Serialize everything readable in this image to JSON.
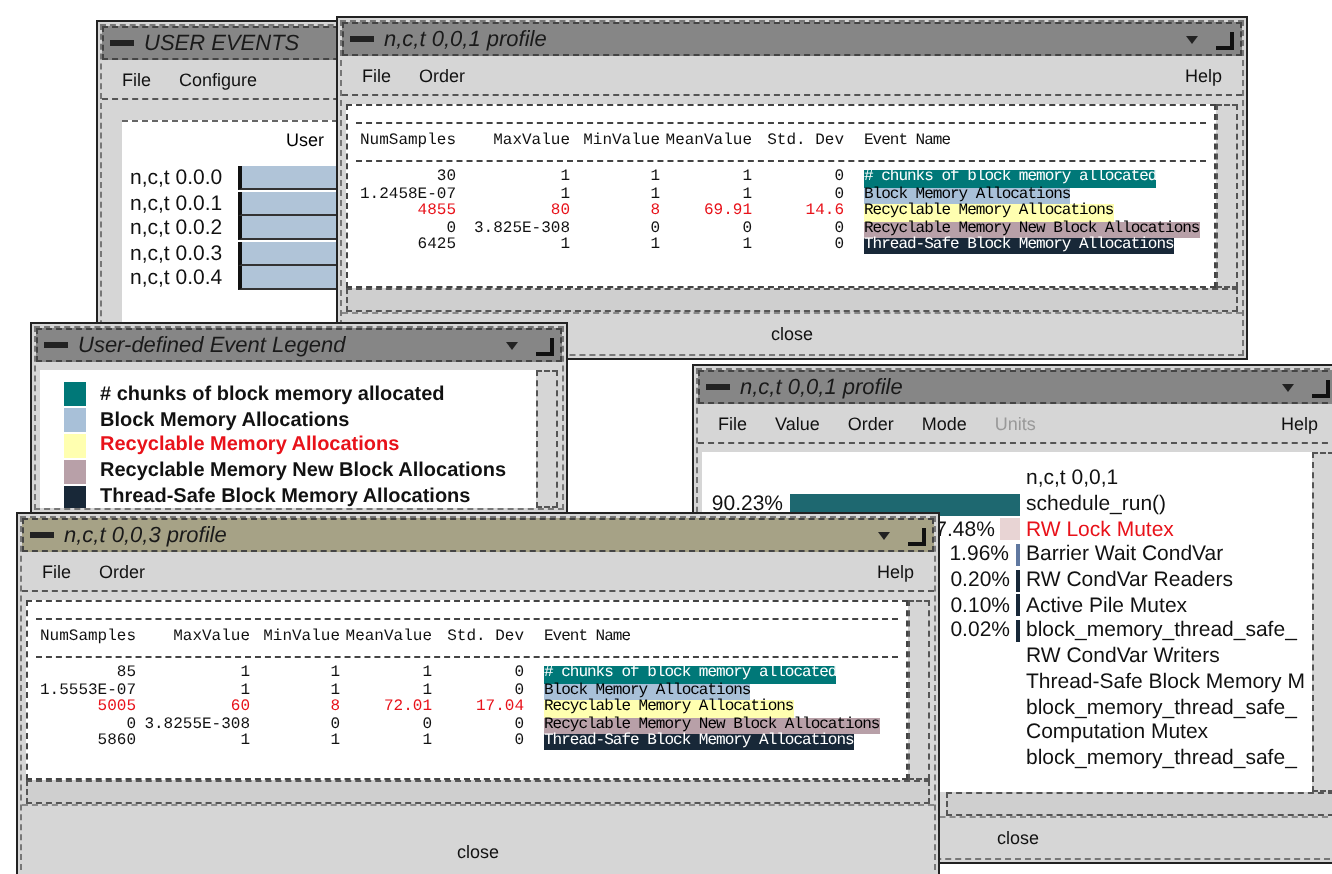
{
  "windows": [
    {
      "kind": "events",
      "title": "USER EVENTS",
      "active": false,
      "menu": [
        {
          "label": "File"
        },
        {
          "label": "Configure"
        }
      ],
      "header": "User",
      "rows": [
        {
          "label": "n,c,t 0.0.0"
        },
        {
          "label": "n,c,t 0.0.1"
        },
        {
          "label": "n,c,t 0.0.2"
        },
        {
          "label": "n,c,t 0.0.3"
        },
        {
          "label": "n,c,t 0.0.4"
        }
      ]
    },
    {
      "kind": "table",
      "title": "n,c,t 0,0,1 profile",
      "active": false,
      "menu": [
        {
          "label": "File"
        },
        {
          "label": "Order"
        }
      ],
      "help": "Help",
      "columns": [
        "NumSamples",
        "MaxValue",
        "MinValue",
        "MeanValue",
        "Std. Dev",
        "Event Name"
      ],
      "rows": [
        {
          "cells": [
            "30",
            "1",
            "1",
            "1",
            "0"
          ],
          "event": "# chunks of block memory allocated",
          "color": "#007878",
          "highlight": false
        },
        {
          "cells": [
            "1.2458E-07",
            "1",
            "1",
            "1",
            "0"
          ],
          "event": "Block Memory Allocations",
          "color": "#a8c0d8",
          "highlight": false
        },
        {
          "cells": [
            "4855",
            "80",
            "8",
            "69.91",
            "14.6"
          ],
          "event": "Recyclable Memory Allocations",
          "color": "#ffffb0",
          "highlight": true
        },
        {
          "cells": [
            "0",
            "3.825E-308",
            "0",
            "0",
            "0"
          ],
          "event": "Recyclable Memory New Block Allocations",
          "color": "#b8a0a8",
          "highlight": false
        },
        {
          "cells": [
            "6425",
            "1",
            "1",
            "1",
            "0"
          ],
          "event": "Thread-Safe Block Memory Allocations",
          "color": "#182838",
          "highlight": false
        }
      ],
      "close": "close"
    },
    {
      "kind": "legend",
      "title": "User-defined Event Legend",
      "active": false,
      "items": [
        {
          "label": "# chunks of block memory allocated",
          "color": "#007878",
          "highlight": false
        },
        {
          "label": "Block Memory Allocations",
          "color": "#a8c0d8",
          "highlight": false
        },
        {
          "label": "Recyclable Memory Allocations",
          "color": "#ffffb0",
          "highlight": true
        },
        {
          "label": "Recyclable Memory New Block Allocations",
          "color": "#b8a0a8",
          "highlight": false
        },
        {
          "label": "Thread-Safe Block Memory Allocations",
          "color": "#182838",
          "highlight": false
        }
      ]
    },
    {
      "kind": "bars",
      "title": "n,c,t 0,0,1 profile",
      "active": false,
      "menu": [
        {
          "label": "File",
          "disabled": false
        },
        {
          "label": "Value",
          "disabled": false
        },
        {
          "label": "Order",
          "disabled": false
        },
        {
          "label": "Mode",
          "disabled": false
        },
        {
          "label": "Units",
          "disabled": true
        }
      ],
      "help": "Help",
      "heading": "n,c,t 0,0,1",
      "rows": [
        {
          "percent": "90.23%",
          "name": "schedule_run()",
          "color": "#1e6870",
          "highlight": false
        },
        {
          "percent": "7.48%",
          "name": "RW Lock Mutex",
          "color": "#e8d4d4",
          "highlight": true
        },
        {
          "percent": "1.96%",
          "name": "Barrier Wait CondVar",
          "color": "#6078a0",
          "highlight": false
        },
        {
          "percent": "0.20%",
          "name": "RW CondVar Readers",
          "color": "#182838",
          "highlight": false
        },
        {
          "percent": "0.10%",
          "name": "Active Pile Mutex",
          "color": "#182838",
          "highlight": false
        },
        {
          "percent": "0.02%",
          "name": "block_memory_thread_safe_",
          "color": "#182838",
          "highlight": false
        },
        {
          "name": "RW CondVar Writers",
          "highlight": false
        },
        {
          "name": "Thread-Safe Block Memory M",
          "highlight": false
        },
        {
          "name": "block_memory_thread_safe_",
          "highlight": false
        },
        {
          "name": "Computation Mutex",
          "highlight": false
        },
        {
          "name": "block_memory_thread_safe_",
          "highlight": false
        }
      ],
      "close": "close"
    },
    {
      "kind": "table",
      "title": "n,c,t 0,0,3 profile",
      "active": true,
      "menu": [
        {
          "label": "File"
        },
        {
          "label": "Order"
        }
      ],
      "help": "Help",
      "columns": [
        "NumSamples",
        "MaxValue",
        "MinValue",
        "MeanValue",
        "Std. Dev",
        "Event Name"
      ],
      "rows": [
        {
          "cells": [
            "85",
            "1",
            "1",
            "1",
            "0"
          ],
          "event": "# chunks of block memory allocated",
          "color": "#007878",
          "highlight": false
        },
        {
          "cells": [
            "1.5553E-07",
            "1",
            "1",
            "1",
            "0"
          ],
          "event": "Block Memory Allocations",
          "color": "#a8c0d8",
          "highlight": false
        },
        {
          "cells": [
            "5005",
            "60",
            "8",
            "72.01",
            "17.04"
          ],
          "event": "Recyclable Memory Allocations",
          "color": "#ffffb0",
          "highlight": true
        },
        {
          "cells": [
            "0",
            "3.8255E-308",
            "0",
            "0",
            "0"
          ],
          "event": "Recyclable Memory New Block Allocations",
          "color": "#b8a0a8",
          "highlight": false
        },
        {
          "cells": [
            "5860",
            "1",
            "1",
            "1",
            "0"
          ],
          "event": "Thread-Safe Block Memory Allocations",
          "color": "#182838",
          "highlight": false
        }
      ],
      "close": "close"
    }
  ]
}
